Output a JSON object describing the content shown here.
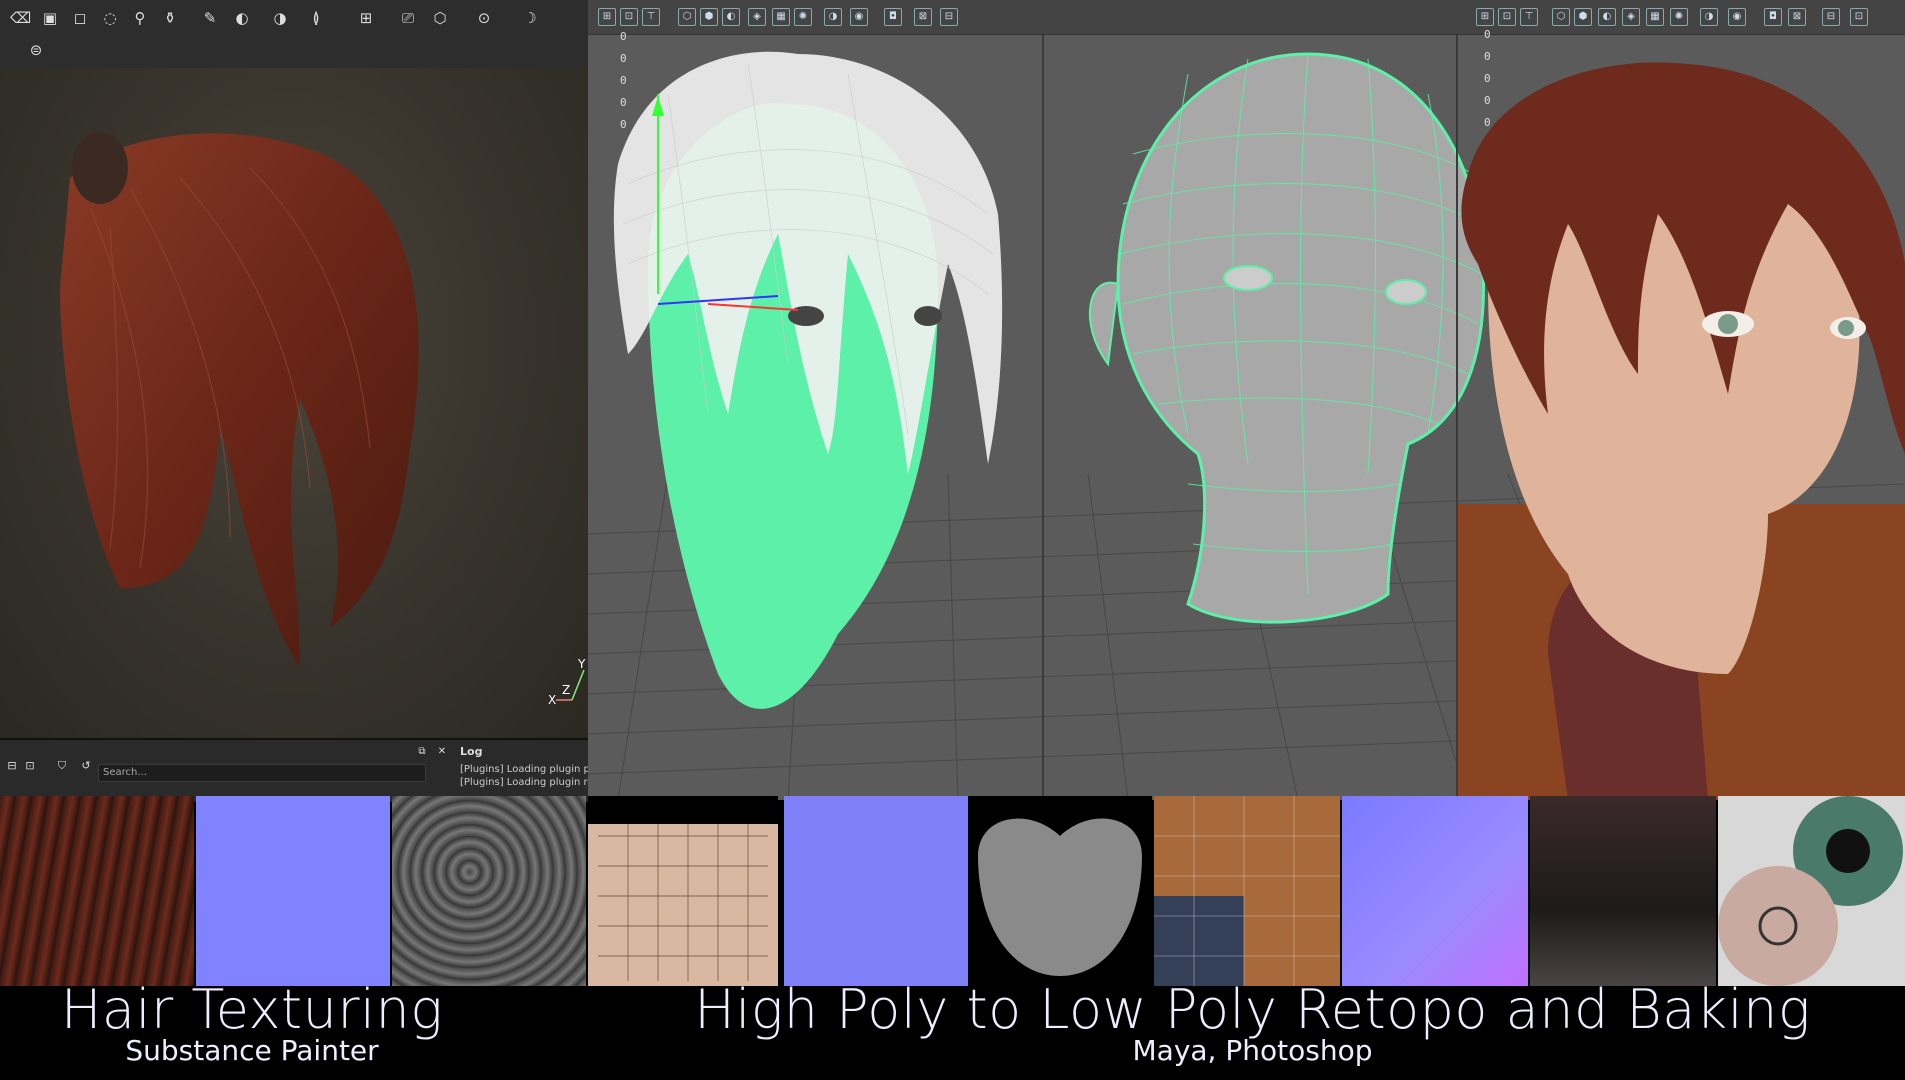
{
  "substance_painter": {
    "axis_labels": {
      "y": "Y",
      "z": "Z",
      "x": "X"
    },
    "search": {
      "placeholder": "Search..."
    },
    "log": {
      "title": "Log",
      "lines": [
        "[Plugins] Loading plugin pho",
        "[Plugins] Loading plugin res"
      ]
    }
  },
  "maya": {
    "hud_left": [
      "0",
      "0",
      "0",
      "0",
      "0"
    ],
    "hud_right": [
      "0",
      "0",
      "0",
      "0",
      "0"
    ]
  },
  "captions": {
    "left": {
      "title": "Hair Texturing",
      "subtitle": "Substance Painter"
    },
    "right": {
      "title": "High Poly to Low Poly Retopo and Baking",
      "subtitle": "Maya, Photoshop"
    }
  },
  "colors": {
    "wire_green": "#5cf0a8",
    "normal_blue": "#8080ff",
    "hair_red": "#6e2a1c",
    "maya_bg": "#5b5b5b"
  }
}
